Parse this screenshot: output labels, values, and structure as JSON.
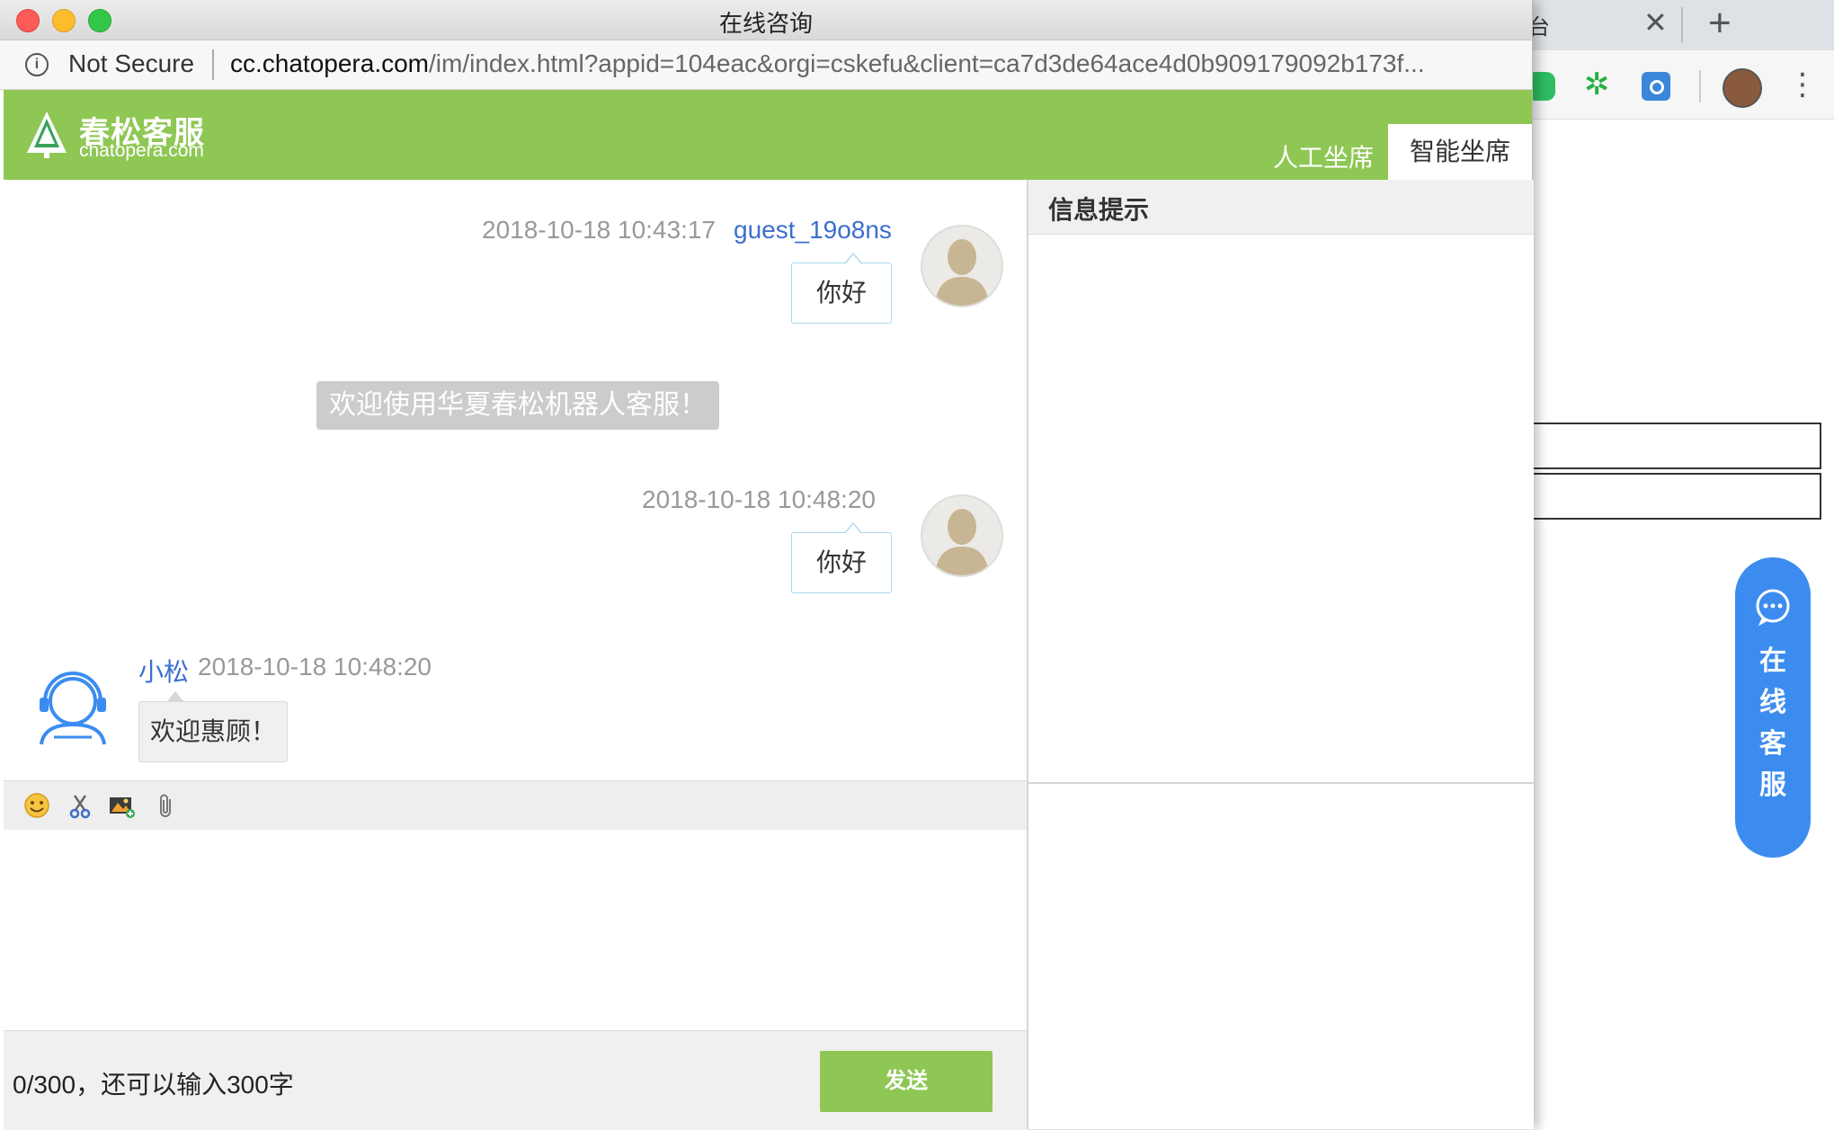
{
  "background_browser": {
    "tab_fragment": "台",
    "tab_close": "✕",
    "new_tab": "+",
    "menu": "⋮",
    "extensions": [
      "evernote-icon",
      "star-extension-icon",
      "blue-extension-icon"
    ],
    "float_chat": {
      "label_chars": [
        "在",
        "线",
        "客",
        "服"
      ],
      "color": "#3c8cf0"
    }
  },
  "window": {
    "title": "在线咨询",
    "security_label": "Not Secure",
    "url_host": "cc.chatopera.com",
    "url_path": "/im/index.html?appid=104eac&orgi=cskefu&client=ca7d3de64ace4d0b909179092b173f..."
  },
  "header": {
    "brand_name": "春松客服",
    "brand_sub": "chatopera.com",
    "tabs": [
      {
        "label": "人工坐席",
        "active": false
      },
      {
        "label": "智能坐席",
        "active": true
      }
    ],
    "color": "#8fc755"
  },
  "messages": [
    {
      "type": "user",
      "timestamp": "2018-10-18 10:43:17",
      "name": "guest_19o8ns",
      "text": "你好"
    },
    {
      "type": "system",
      "text": "欢迎使用华夏春松机器人客服！"
    },
    {
      "type": "user",
      "timestamp": "2018-10-18 10:48:20",
      "name": "",
      "text": "你好"
    },
    {
      "type": "bot",
      "name": "小松",
      "timestamp": "2018-10-18 10:48:20",
      "text": "欢迎惠顾！"
    }
  ],
  "toolbar": {
    "icons": [
      "emoji-icon",
      "scissors-icon",
      "image-upload-icon",
      "attachment-icon"
    ]
  },
  "composer": {
    "value": "",
    "counter": "0/300，还可以输入300字",
    "send_label": "发送"
  },
  "info_panel": {
    "title": "信息提示"
  }
}
